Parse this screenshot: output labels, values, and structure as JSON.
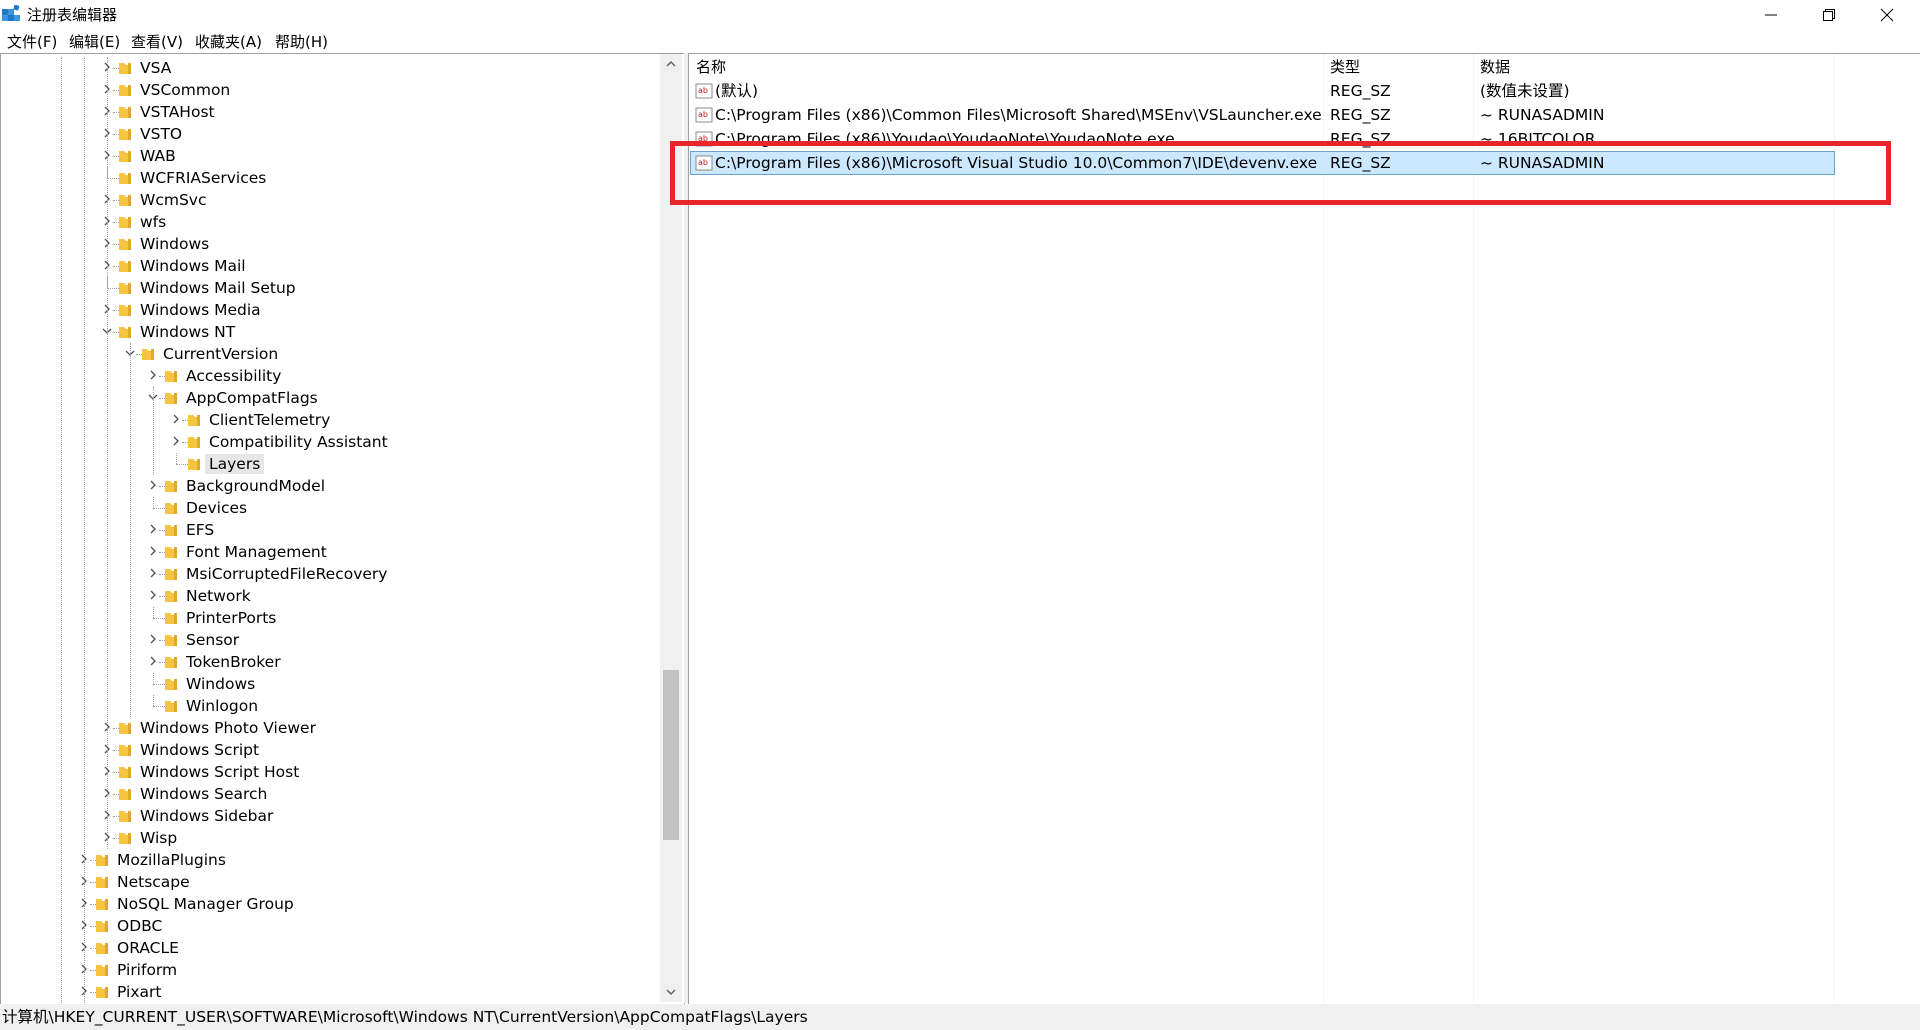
{
  "window": {
    "title": "注册表编辑器",
    "app_icon": "registry-editor-icon",
    "controls": [
      "minimize-icon",
      "restore-icon",
      "close-icon"
    ]
  },
  "menu": [
    "文件(F)",
    "编辑(E)",
    "查看(V)",
    "收藏夹(A)",
    "帮助(H)"
  ],
  "tree": [
    {
      "label": "VSA",
      "depth": 4,
      "expander": "collapsed"
    },
    {
      "label": "VSCommon",
      "depth": 4,
      "expander": "collapsed"
    },
    {
      "label": "VSTAHost",
      "depth": 4,
      "expander": "collapsed"
    },
    {
      "label": "VSTO",
      "depth": 4,
      "expander": "collapsed"
    },
    {
      "label": "WAB",
      "depth": 4,
      "expander": "collapsed"
    },
    {
      "label": "WCFRIAServices",
      "depth": 4,
      "expander": "none"
    },
    {
      "label": "WcmSvc",
      "depth": 4,
      "expander": "collapsed"
    },
    {
      "label": "wfs",
      "depth": 4,
      "expander": "collapsed"
    },
    {
      "label": "Windows",
      "depth": 4,
      "expander": "collapsed"
    },
    {
      "label": "Windows Mail",
      "depth": 4,
      "expander": "collapsed"
    },
    {
      "label": "Windows Mail Setup",
      "depth": 4,
      "expander": "none"
    },
    {
      "label": "Windows Media",
      "depth": 4,
      "expander": "collapsed"
    },
    {
      "label": "Windows NT",
      "depth": 4,
      "expander": "expanded"
    },
    {
      "label": "CurrentVersion",
      "depth": 5,
      "expander": "expanded"
    },
    {
      "label": "Accessibility",
      "depth": 6,
      "expander": "collapsed"
    },
    {
      "label": "AppCompatFlags",
      "depth": 6,
      "expander": "expanded"
    },
    {
      "label": "ClientTelemetry",
      "depth": 7,
      "expander": "collapsed"
    },
    {
      "label": "Compatibility Assistant",
      "depth": 7,
      "expander": "collapsed"
    },
    {
      "label": "Layers",
      "depth": 7,
      "expander": "none",
      "selected": true
    },
    {
      "label": "BackgroundModel",
      "depth": 6,
      "expander": "collapsed"
    },
    {
      "label": "Devices",
      "depth": 6,
      "expander": "none"
    },
    {
      "label": "EFS",
      "depth": 6,
      "expander": "collapsed"
    },
    {
      "label": "Font Management",
      "depth": 6,
      "expander": "collapsed"
    },
    {
      "label": "MsiCorruptedFileRecovery",
      "depth": 6,
      "expander": "collapsed"
    },
    {
      "label": "Network",
      "depth": 6,
      "expander": "collapsed"
    },
    {
      "label": "PrinterPorts",
      "depth": 6,
      "expander": "none"
    },
    {
      "label": "Sensor",
      "depth": 6,
      "expander": "collapsed"
    },
    {
      "label": "TokenBroker",
      "depth": 6,
      "expander": "collapsed"
    },
    {
      "label": "Windows",
      "depth": 6,
      "expander": "none"
    },
    {
      "label": "Winlogon",
      "depth": 6,
      "expander": "none"
    },
    {
      "label": "Windows Photo Viewer",
      "depth": 4,
      "expander": "collapsed"
    },
    {
      "label": "Windows Script",
      "depth": 4,
      "expander": "collapsed"
    },
    {
      "label": "Windows Script Host",
      "depth": 4,
      "expander": "collapsed"
    },
    {
      "label": "Windows Search",
      "depth": 4,
      "expander": "collapsed"
    },
    {
      "label": "Windows Sidebar",
      "depth": 4,
      "expander": "collapsed"
    },
    {
      "label": "Wisp",
      "depth": 4,
      "expander": "collapsed"
    },
    {
      "label": "MozillaPlugins",
      "depth": 3,
      "expander": "collapsed"
    },
    {
      "label": "Netscape",
      "depth": 3,
      "expander": "collapsed"
    },
    {
      "label": "NoSQL Manager Group",
      "depth": 3,
      "expander": "collapsed"
    },
    {
      "label": "ODBC",
      "depth": 3,
      "expander": "collapsed"
    },
    {
      "label": "ORACLE",
      "depth": 3,
      "expander": "collapsed"
    },
    {
      "label": "Piriform",
      "depth": 3,
      "expander": "collapsed"
    },
    {
      "label": "Pixart",
      "depth": 3,
      "expander": "collapsed"
    }
  ],
  "list": {
    "columns": [
      "名称",
      "类型",
      "数据"
    ],
    "rows": [
      {
        "name": "(默认)",
        "type": "REG_SZ",
        "data": "(数值未设置)"
      },
      {
        "name": "C:\\Program Files (x86)\\Common Files\\Microsoft Shared\\MSEnv\\VSLauncher.exe",
        "type": "REG_SZ",
        "data": "~ RUNASADMIN"
      },
      {
        "name": "C:\\Program Files (x86)\\Youdao\\YoudaoNote\\YoudaoNote.exe",
        "type": "REG_SZ",
        "data": "~ 16BITCOLOR"
      },
      {
        "name": "C:\\Program Files (x86)\\Microsoft Visual Studio 10.0\\Common7\\IDE\\devenv.exe",
        "type": "REG_SZ",
        "data": "~ RUNASADMIN",
        "selected": true
      }
    ]
  },
  "status": "计算机\\HKEY_CURRENT_USER\\SOFTWARE\\Microsoft\\Windows NT\\CurrentVersion\\AppCompatFlags\\Layers",
  "colors": {
    "highlight_box": "#e8252b",
    "selection": "#cce8ff",
    "folder": "#f5c542"
  }
}
